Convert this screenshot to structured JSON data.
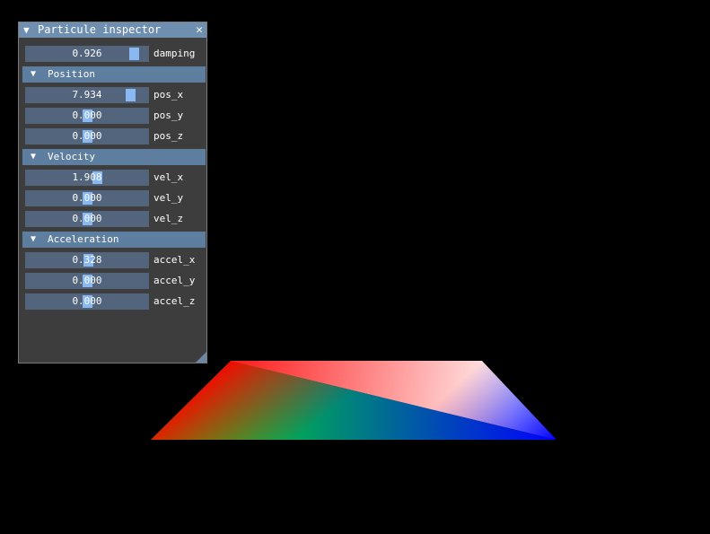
{
  "window": {
    "title": "Particule inspector",
    "collapse_arrow": "▼",
    "close_glyph": "✕"
  },
  "damping": {
    "value": "0.926",
    "label": "damping",
    "fraction": 0.926
  },
  "sections": [
    {
      "title": "Position",
      "arrow": "▼",
      "rows": [
        {
          "value": "7.934",
          "label": "pos_x",
          "fraction": 0.897
        },
        {
          "value": "0.000",
          "label": "pos_y",
          "fraction": 0.5
        },
        {
          "value": "0.000",
          "label": "pos_z",
          "fraction": 0.5
        }
      ]
    },
    {
      "title": "Velocity",
      "arrow": "▼",
      "rows": [
        {
          "value": "1.908",
          "label": "vel_x",
          "fraction": 0.595
        },
        {
          "value": "0.000",
          "label": "vel_y",
          "fraction": 0.5
        },
        {
          "value": "0.000",
          "label": "vel_z",
          "fraction": 0.5
        }
      ]
    },
    {
      "title": "Acceleration",
      "arrow": "▼",
      "rows": [
        {
          "value": "0.328",
          "label": "accel_x",
          "fraction": 0.516
        },
        {
          "value": "0.000",
          "label": "accel_y",
          "fraction": 0.5
        },
        {
          "value": "0.000",
          "label": "accel_z",
          "fraction": 0.5
        }
      ]
    }
  ],
  "colors": {
    "background": "#000000",
    "title_bar": "#6f8fb1",
    "section_header": "#5e7e9f",
    "slider_frame": "#52657c",
    "slider_grab": "#89b9f0",
    "window_bg": "#3d3d3d"
  },
  "scene": {
    "shape": "gradient-quad",
    "vertex_colors": [
      "#ff0000",
      "#ffffff",
      "#0000ff",
      "#00ff00"
    ]
  }
}
